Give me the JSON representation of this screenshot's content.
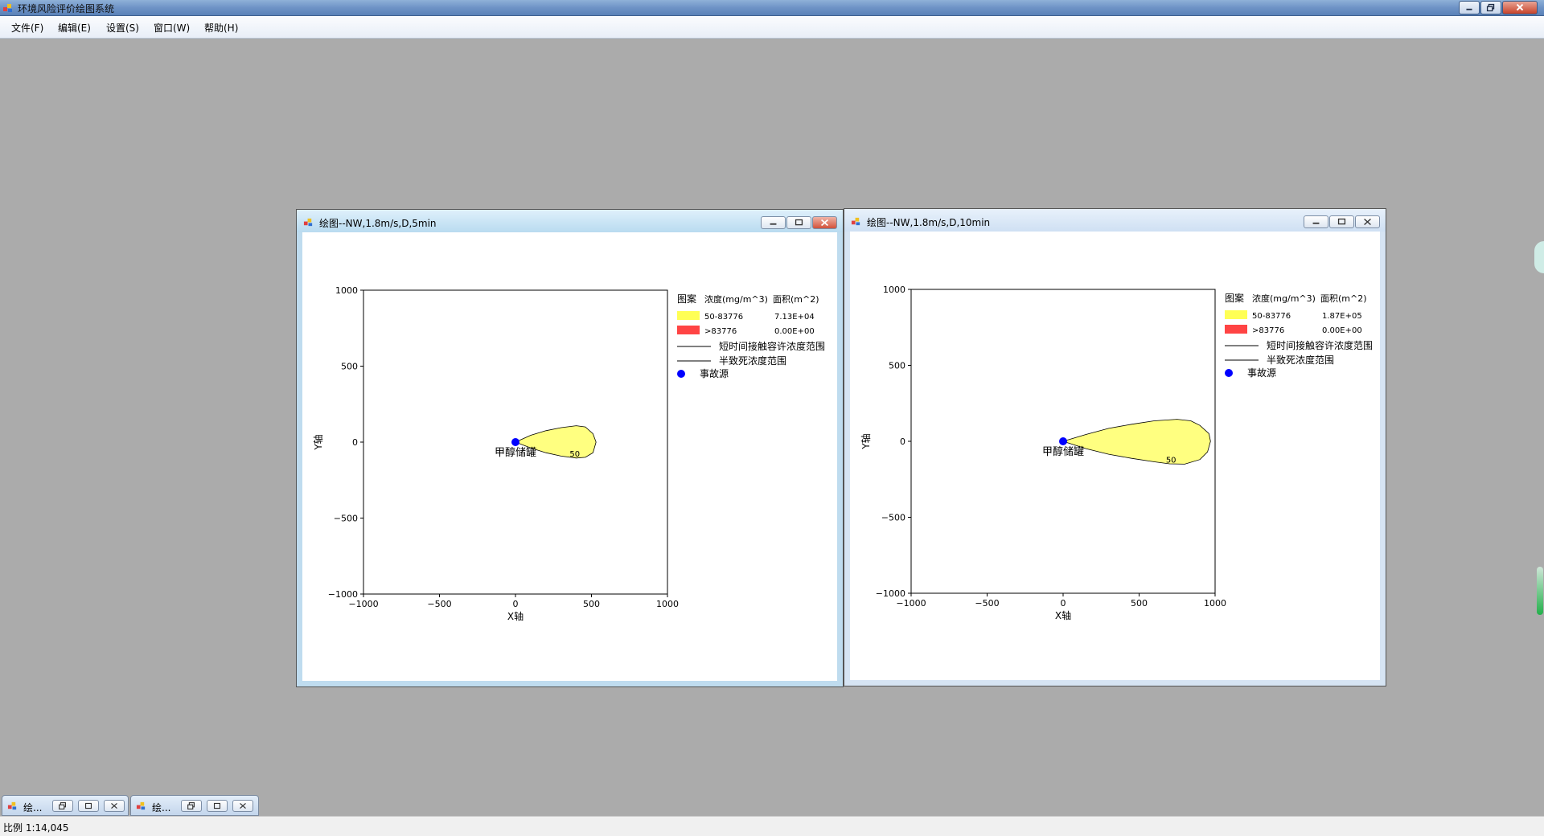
{
  "app": {
    "title": "环境风险评价绘图系统"
  },
  "menu": {
    "file": "文件(F)",
    "edit": "编辑(E)",
    "settings": "设置(S)",
    "window": "窗口(W)",
    "help": "帮助(H)"
  },
  "windows": [
    {
      "title": "绘图--NW,1.8m/s,D,5min",
      "legend": {
        "header_pattern": "图案",
        "header_conc": "浓度(mg/m^3)",
        "header_area": "面积(m^2)",
        "rows": [
          {
            "conc": "50-83776",
            "area": "7.13E+04",
            "color": "#ffff55"
          },
          {
            "conc": ">83776",
            "area": "0.00E+00",
            "color": "#ff4444"
          }
        ],
        "line1": "短时间接触容许浓度范围",
        "line2": "半致死浓度范围",
        "source": "事故源"
      }
    },
    {
      "title": "绘图--NW,1.8m/s,D,10min",
      "legend": {
        "header_pattern": "图案",
        "header_conc": "浓度(mg/m^3)",
        "header_area": "面积(m^2)",
        "rows": [
          {
            "conc": "50-83776",
            "area": "1.87E+05",
            "color": "#ffff55"
          },
          {
            "conc": ">83776",
            "area": "0.00E+00",
            "color": "#ff4444"
          }
        ],
        "line1": "短时间接触容许浓度范围",
        "line2": "半致死浓度范围",
        "source": "事故源"
      }
    }
  ],
  "chart_data": [
    {
      "type": "area",
      "title": "",
      "xlabel": "X轴",
      "ylabel": "Y轴",
      "xlim": [
        -1000,
        1000
      ],
      "ylim": [
        -1000,
        1000
      ],
      "xticks": [
        "−1000",
        "−500",
        "0",
        "500",
        "1000"
      ],
      "yticks": [
        "1000",
        "500",
        "0",
        "−500",
        "−1000"
      ],
      "source_label": "甲醇储罐",
      "source_point": [
        0,
        0
      ],
      "contour_label": "50",
      "contour_label_at": [
        390,
        -95
      ],
      "contour": [
        [
          0,
          0
        ],
        [
          100,
          45
        ],
        [
          200,
          75
        ],
        [
          300,
          95
        ],
        [
          400,
          108
        ],
        [
          460,
          100
        ],
        [
          510,
          55
        ],
        [
          530,
          0
        ],
        [
          510,
          -70
        ],
        [
          460,
          -100
        ],
        [
          400,
          -105
        ],
        [
          300,
          -92
        ],
        [
          200,
          -70
        ],
        [
          100,
          -38
        ],
        [
          0,
          0
        ]
      ]
    },
    {
      "type": "area",
      "title": "",
      "xlabel": "X轴",
      "ylabel": "Y轴",
      "xlim": [
        -1000,
        1000
      ],
      "ylim": [
        -1000,
        1000
      ],
      "xticks": [
        "−1000",
        "−500",
        "0",
        "500",
        "1000"
      ],
      "yticks": [
        "1000",
        "500",
        "0",
        "−500",
        "−1000"
      ],
      "source_label": "甲醇储罐",
      "source_point": [
        0,
        0
      ],
      "contour_label": "50",
      "contour_label_at": [
        710,
        -140
      ],
      "contour": [
        [
          0,
          0
        ],
        [
          150,
          45
        ],
        [
          300,
          85
        ],
        [
          450,
          112
        ],
        [
          600,
          135
        ],
        [
          750,
          145
        ],
        [
          840,
          135
        ],
        [
          900,
          105
        ],
        [
          960,
          50
        ],
        [
          970,
          0
        ],
        [
          950,
          -70
        ],
        [
          900,
          -120
        ],
        [
          800,
          -150
        ],
        [
          700,
          -148
        ],
        [
          600,
          -135
        ],
        [
          450,
          -112
        ],
        [
          300,
          -85
        ],
        [
          150,
          -48
        ],
        [
          0,
          0
        ]
      ]
    }
  ],
  "minimized": [
    {
      "label": "绘..."
    },
    {
      "label": "绘..."
    }
  ],
  "status": {
    "scale": "比例 1:14,045"
  }
}
